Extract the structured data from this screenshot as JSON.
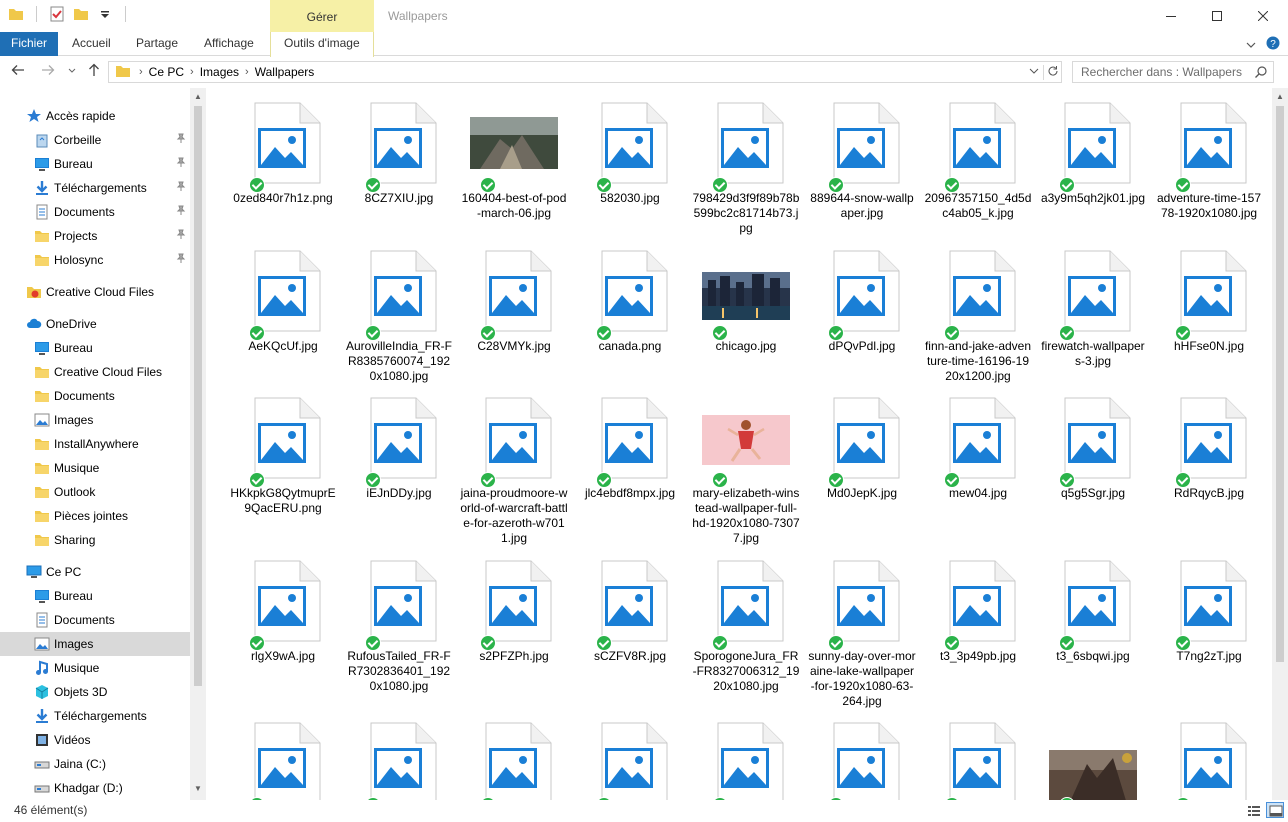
{
  "window": {
    "title": "Wallpapers",
    "contextual_group": "Gérer"
  },
  "ribbon": {
    "tabs": [
      "Fichier",
      "Accueil",
      "Partage",
      "Affichage",
      "Outils d'image"
    ]
  },
  "address": {
    "crumbs": [
      "Ce PC",
      "Images",
      "Wallpapers"
    ],
    "search_placeholder": "Rechercher dans : Wallpapers"
  },
  "sidebar": {
    "items": [
      {
        "label": "Accès rapide",
        "icon": "star-icon",
        "level": 0,
        "pinned": false
      },
      {
        "label": "Corbeille",
        "icon": "recycle-bin-icon",
        "level": 1,
        "pinned": true
      },
      {
        "label": "Bureau",
        "icon": "desktop-icon",
        "level": 1,
        "pinned": true
      },
      {
        "label": "Téléchargements",
        "icon": "download-icon",
        "level": 1,
        "pinned": true
      },
      {
        "label": "Documents",
        "icon": "documents-icon",
        "level": 1,
        "pinned": true
      },
      {
        "label": "Projects",
        "icon": "folder-icon",
        "level": 1,
        "pinned": true
      },
      {
        "label": "Holosync",
        "icon": "folder-icon",
        "level": 1,
        "pinned": true
      },
      {
        "label": "Creative Cloud Files",
        "icon": "creative-cloud-icon",
        "level": 0,
        "pinned": false
      },
      {
        "label": "OneDrive",
        "icon": "cloud-icon",
        "level": 0,
        "pinned": false
      },
      {
        "label": "Bureau",
        "icon": "desktop-icon",
        "level": 1,
        "pinned": false
      },
      {
        "label": "Creative Cloud Files",
        "icon": "folder-icon",
        "level": 1,
        "pinned": false
      },
      {
        "label": "Documents",
        "icon": "folder-icon",
        "level": 1,
        "pinned": false
      },
      {
        "label": "Images",
        "icon": "images-icon",
        "level": 1,
        "pinned": false
      },
      {
        "label": "InstallAnywhere",
        "icon": "folder-icon",
        "level": 1,
        "pinned": false
      },
      {
        "label": "Musique",
        "icon": "folder-icon",
        "level": 1,
        "pinned": false
      },
      {
        "label": "Outlook",
        "icon": "folder-icon",
        "level": 1,
        "pinned": false
      },
      {
        "label": "Pièces jointes",
        "icon": "folder-icon",
        "level": 1,
        "pinned": false
      },
      {
        "label": "Sharing",
        "icon": "folder-icon",
        "level": 1,
        "pinned": false
      },
      {
        "label": "Ce PC",
        "icon": "computer-icon",
        "level": 0,
        "pinned": false
      },
      {
        "label": "Bureau",
        "icon": "desktop-icon",
        "level": 1,
        "pinned": false
      },
      {
        "label": "Documents",
        "icon": "documents-icon",
        "level": 1,
        "pinned": false
      },
      {
        "label": "Images",
        "icon": "images-icon",
        "level": 1,
        "pinned": false,
        "selected": true
      },
      {
        "label": "Musique",
        "icon": "music-icon",
        "level": 1,
        "pinned": false
      },
      {
        "label": "Objets 3D",
        "icon": "cube-icon",
        "level": 1,
        "pinned": false
      },
      {
        "label": "Téléchargements",
        "icon": "download-icon",
        "level": 1,
        "pinned": false
      },
      {
        "label": "Vidéos",
        "icon": "video-icon",
        "level": 1,
        "pinned": false
      },
      {
        "label": "Jaina (C:)",
        "icon": "drive-icon",
        "level": 1,
        "pinned": false
      },
      {
        "label": "Khadgar (D:)",
        "icon": "drive-icon",
        "level": 1,
        "pinned": false
      }
    ]
  },
  "files": [
    {
      "name": "0zed840r7h1z.png",
      "thumb": "generic"
    },
    {
      "name": "8CZ7XIU.jpg",
      "thumb": "generic"
    },
    {
      "name": "160404-best-of-pod-march-06.jpg",
      "thumb": "photo-rocks"
    },
    {
      "name": "582030.jpg",
      "thumb": "generic"
    },
    {
      "name": "798429d3f9f89b78b599bc2c81714b73.jpg",
      "thumb": "generic"
    },
    {
      "name": "889644-snow-wallpaper.jpg",
      "thumb": "generic"
    },
    {
      "name": "20967357150_4d5dc4ab05_k.jpg",
      "thumb": "generic"
    },
    {
      "name": "a3y9m5qh2jk01.jpg",
      "thumb": "generic"
    },
    {
      "name": "adventure-time-15778-1920x1080.jpg",
      "thumb": "generic"
    },
    {
      "name": "AeKQcUf.jpg",
      "thumb": "generic"
    },
    {
      "name": "AurovilleIndia_FR-FR8385760074_1920x1080.jpg",
      "thumb": "generic"
    },
    {
      "name": "C28VMYk.jpg",
      "thumb": "generic"
    },
    {
      "name": "canada.png",
      "thumb": "generic"
    },
    {
      "name": "chicago.jpg",
      "thumb": "photo-city"
    },
    {
      "name": "dPQvPdl.jpg",
      "thumb": "generic"
    },
    {
      "name": "finn-and-jake-adventure-time-16196-1920x1200.jpg",
      "thumb": "generic"
    },
    {
      "name": "firewatch-wallpapers-3.jpg",
      "thumb": "generic"
    },
    {
      "name": "hHFse0N.jpg",
      "thumb": "generic"
    },
    {
      "name": "HKkpkG8QytmuprE9QacERU.png",
      "thumb": "generic"
    },
    {
      "name": "iEJnDDy.jpg",
      "thumb": "generic"
    },
    {
      "name": "jaina-proudmoore-world-of-warcraft-battle-for-azeroth-w7011.jpg",
      "thumb": "generic"
    },
    {
      "name": "jlc4ebdf8mpx.jpg",
      "thumb": "generic"
    },
    {
      "name": "mary-elizabeth-winstead-wallpaper-full-hd-1920x1080-73077.jpg",
      "thumb": "photo-pink"
    },
    {
      "name": "Md0JepK.jpg",
      "thumb": "generic"
    },
    {
      "name": "mew04.jpg",
      "thumb": "generic"
    },
    {
      "name": "q5g5Sgr.jpg",
      "thumb": "generic"
    },
    {
      "name": "RdRqycB.jpg",
      "thumb": "generic"
    },
    {
      "name": "rlgX9wA.jpg",
      "thumb": "generic"
    },
    {
      "name": "RufousTailed_FR-FR7302836401_1920x1080.jpg",
      "thumb": "generic"
    },
    {
      "name": "s2PFZPh.jpg",
      "thumb": "generic"
    },
    {
      "name": "sCZFV8R.jpg",
      "thumb": "generic"
    },
    {
      "name": "SporogoneJura_FR-FR8327006312_1920x1080.jpg",
      "thumb": "generic"
    },
    {
      "name": "sunny-day-over-moraine-lake-wallpaper-for-1920x1080-63-264.jpg",
      "thumb": "generic"
    },
    {
      "name": "t3_3p49pb.jpg",
      "thumb": "generic"
    },
    {
      "name": "t3_6sbqwi.jpg",
      "thumb": "generic"
    },
    {
      "name": "T7ng2zT.jpg",
      "thumb": "generic"
    },
    {
      "name": "",
      "thumb": "generic"
    },
    {
      "name": "",
      "thumb": "generic"
    },
    {
      "name": "",
      "thumb": "generic"
    },
    {
      "name": "",
      "thumb": "generic"
    },
    {
      "name": "",
      "thumb": "generic"
    },
    {
      "name": "",
      "thumb": "generic"
    },
    {
      "name": "",
      "thumb": "generic"
    },
    {
      "name": "",
      "thumb": "photo-warcraft"
    },
    {
      "name": "",
      "thumb": "generic"
    }
  ],
  "status": {
    "count": "46 élément(s)"
  },
  "colors": {
    "file_tab": "#1f6fb5",
    "manage_tab": "#f6f0a6",
    "image_icon_blue": "#1a7fd6",
    "sync_check": "#2bb34a",
    "selection": "#d9d9d9"
  }
}
